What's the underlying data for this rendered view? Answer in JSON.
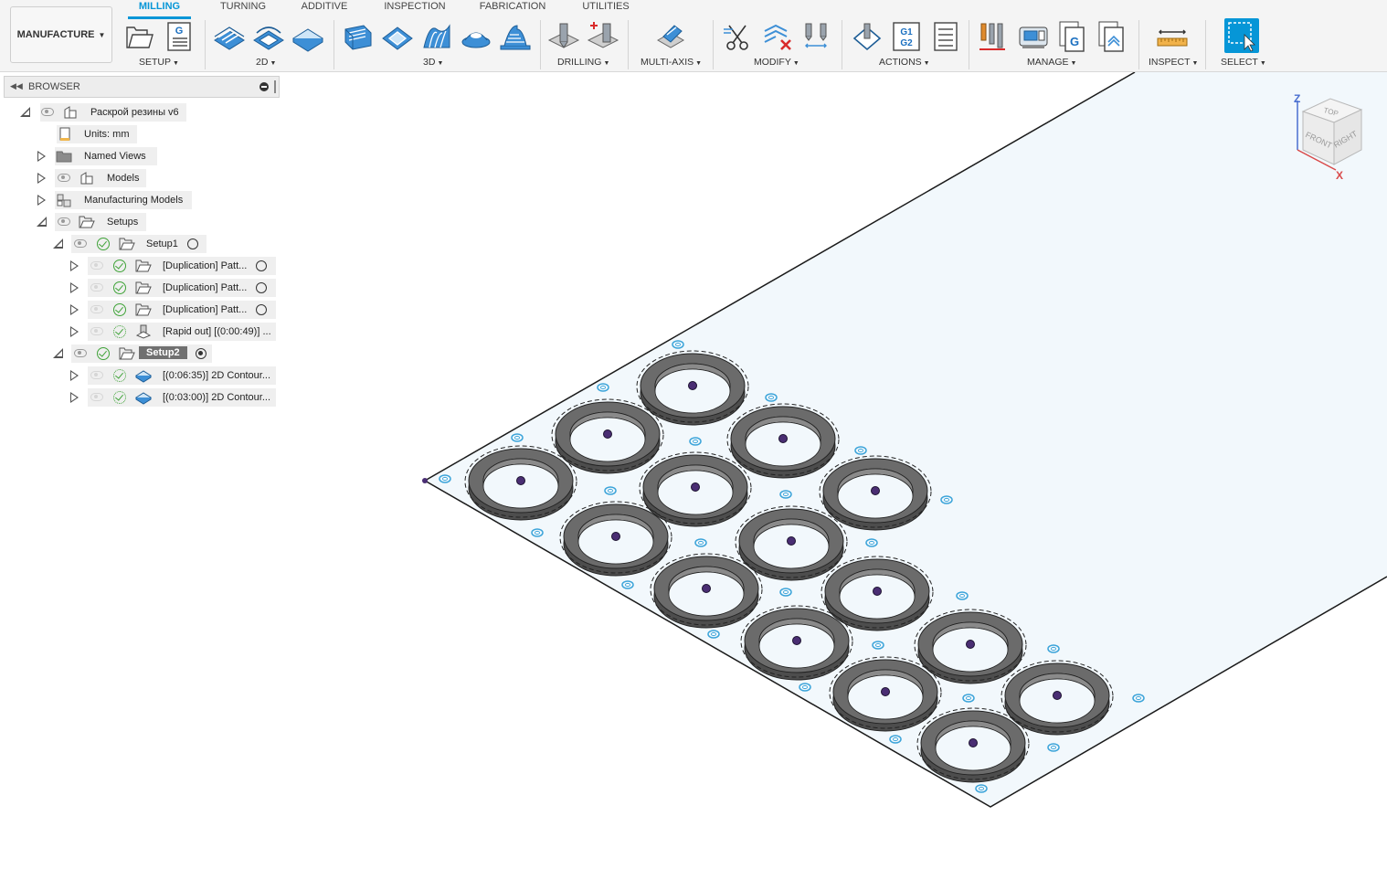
{
  "workspace": {
    "label": "MANUFACTURE"
  },
  "tabs": [
    {
      "label": "MILLING",
      "active": true
    },
    {
      "label": "TURNING",
      "active": false
    },
    {
      "label": "ADDITIVE",
      "active": false
    },
    {
      "label": "INSPECTION",
      "active": false
    },
    {
      "label": "FABRICATION",
      "active": false
    },
    {
      "label": "UTILITIES",
      "active": false
    }
  ],
  "groups": {
    "setup": "SETUP",
    "two_d": "2D",
    "three_d": "3D",
    "drilling": "DRILLING",
    "multi_axis": "MULTI-AXIS",
    "modify": "MODIFY",
    "actions": "ACTIONS",
    "manage": "MANAGE",
    "inspect": "INSPECT",
    "select": "SELECT"
  },
  "toolbar_icon_text": {
    "nc_program": "G",
    "post_g1": "G1",
    "post_g2": "G2",
    "manage_g": "G"
  },
  "browser": {
    "title": "BROWSER",
    "items": [
      {
        "label": "Раскрой резины v6"
      },
      {
        "label": "Units: mm"
      },
      {
        "label": "Named Views"
      },
      {
        "label": "Models"
      },
      {
        "label": "Manufacturing Models"
      },
      {
        "label": "Setups"
      },
      {
        "label": "Setup1"
      },
      {
        "label": "[Duplication] Patt..."
      },
      {
        "label": "[Duplication] Patt..."
      },
      {
        "label": "[Duplication] Patt..."
      },
      {
        "label": "[Rapid out] [(0:00:49)] ..."
      },
      {
        "label": "Setup2"
      },
      {
        "label": "[(0:06:35)] 2D Contour..."
      },
      {
        "label": "[(0:03:00)] 2D Contour..."
      }
    ]
  },
  "viewcube": {
    "top": "TOP",
    "front": "FRONT",
    "right": "RIGHT",
    "axis_z": "Z",
    "axis_x": "X"
  },
  "colors": {
    "accent": "#0696d7",
    "ring": "#5a5a5a",
    "sheet": "#f2f8fc"
  }
}
